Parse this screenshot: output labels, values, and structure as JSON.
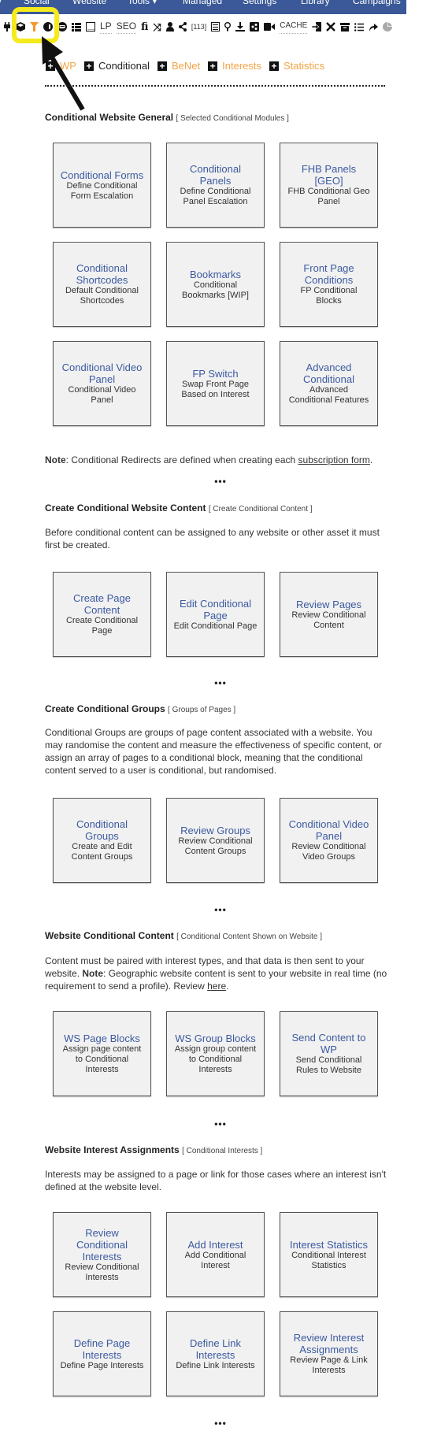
{
  "topnav": {
    "items": [
      "Social",
      "Website",
      "Tools ▾",
      "Managed",
      "Settings",
      "Library",
      "Campaigns"
    ],
    "bg_color": "#3b5998"
  },
  "toolbar": {
    "items": [
      {
        "icon": "plug-icon",
        "glyph": "🔌"
      },
      {
        "icon": "cube-icon",
        "glyph": "⬢"
      },
      {
        "icon": "filter-icon",
        "glyph": "▼",
        "highlighted": true
      },
      {
        "icon": "info-icon",
        "glyph": "❶"
      },
      {
        "icon": "newspaper-icon",
        "glyph": "▣"
      },
      {
        "icon": "list-icon",
        "glyph": "☰"
      },
      {
        "icon": "window-icon",
        "glyph": "☐"
      },
      {
        "text": "LP"
      },
      {
        "text": "SEO"
      },
      {
        "icon": "fi-icon",
        "glyph": "fi"
      },
      {
        "icon": "shuffle-icon",
        "glyph": "⤨"
      },
      {
        "icon": "user-icon",
        "glyph": "●"
      },
      {
        "icon": "share-icon",
        "glyph": "<"
      },
      {
        "text": "[113]"
      },
      {
        "icon": "form-icon",
        "glyph": "▤"
      },
      {
        "icon": "lightbulb-icon",
        "glyph": "♀"
      },
      {
        "icon": "download-icon",
        "glyph": "⤓"
      },
      {
        "icon": "share-square-icon",
        "glyph": "◨"
      },
      {
        "icon": "video-icon",
        "glyph": "■"
      },
      {
        "text": "CACHE"
      },
      {
        "icon": "sign-in-icon",
        "glyph": "⇥"
      },
      {
        "icon": "tools-icon",
        "glyph": "✕"
      },
      {
        "icon": "archive-icon",
        "glyph": "▬"
      },
      {
        "icon": "list-ul-icon",
        "glyph": "≡"
      },
      {
        "icon": "reply-arrow-icon",
        "glyph": "↱"
      },
      {
        "icon": "pie-chart-icon",
        "glyph": "◕"
      }
    ],
    "highlight_color": "#f5ea1b"
  },
  "categories": [
    {
      "label": "WP",
      "active": false
    },
    {
      "label": "Conditional",
      "active": true
    },
    {
      "label": "BeNet",
      "active": false
    },
    {
      "label": "Interests",
      "active": false
    },
    {
      "label": "Statistics",
      "active": false
    }
  ],
  "sections": {
    "general": {
      "title": "Conditional Website General",
      "subtitle": "[ Selected Conditional Modules ]",
      "cards": [
        {
          "title": "Conditional Forms",
          "desc": "Define Conditional Form Escalation"
        },
        {
          "title": "Conditional Panels",
          "desc": "Define Conditional Panel Escalation"
        },
        {
          "title": "FHB Panels [GEO]",
          "desc": "FHB Conditional Geo Panel"
        },
        {
          "title": "Conditional Shortcodes",
          "desc": "Default Conditional Shortcodes"
        },
        {
          "title": "Bookmarks",
          "desc": "Conditional Bookmarks [WIP]"
        },
        {
          "title": "Front Page Conditions",
          "desc": "FP Conditional Blocks"
        },
        {
          "title": "Conditional Video Panel",
          "desc": "Conditional Video Panel"
        },
        {
          "title": "FP Switch",
          "desc": "Swap Front Page Based on Interest"
        },
        {
          "title": "Advanced Conditional",
          "desc": "Advanced Conditional Features"
        }
      ],
      "note_label": "Note",
      "note_text": ": Conditional Redirects are defined when creating each ",
      "note_link": "subscription form",
      "note_end": "."
    },
    "content": {
      "title": "Create Conditional Website Content",
      "subtitle": "[ Create Conditional Content ]",
      "text": "Before conditional content can be assigned to any website or other asset it must first be created.",
      "cards": [
        {
          "title": "Create Page Content",
          "desc": "Create Conditional Page"
        },
        {
          "title": "Edit Conditional Page",
          "desc": "Edit Conditional Page"
        },
        {
          "title": "Review Pages",
          "desc": "Review Conditional Content"
        }
      ]
    },
    "groups": {
      "title": "Create Conditional Groups",
      "subtitle": "[ Groups of Pages ]",
      "text": "Conditional Groups are groups of page content associated with a website. You may randomise the content and measure the effectiveness of specific content, or assign an array of pages to a conditional block, meaning that the conditional content served to a user is conditional, but randomised.",
      "cards": [
        {
          "title": "Conditional Groups",
          "desc": "Create and Edit Content Groups"
        },
        {
          "title": "Review Groups",
          "desc": "Review Conditional Content Groups"
        },
        {
          "title": "Conditional Video Panel",
          "desc": "Review Conditional Video Groups"
        }
      ]
    },
    "website": {
      "title": "Website Conditional Content",
      "subtitle": "[ Conditional Content Shown on Website ]",
      "text_a": "Content must be paired with interest types, and that data is then sent to your website. ",
      "note_label": "Note",
      "text_b": ": Geographic website content is sent to your website in real time (no requirement to send a profile). Review ",
      "link": "here",
      "text_end": ".",
      "cards": [
        {
          "title": "WS Page Blocks",
          "desc": "Assign page content to Conditional Interests"
        },
        {
          "title": "WS Group Blocks",
          "desc": "Assign group content to Conditional Interests"
        },
        {
          "title": "Send Content to WP",
          "desc": "Send Conditional Rules to Website"
        }
      ]
    },
    "interests": {
      "title": "Website Interest Assignments",
      "subtitle": "[ Conditional Interests ]",
      "text": "Interests may be assigned to a page or link for those cases where an interest isn't defined at the website level.",
      "cards": [
        {
          "title": "Review Conditional Interests",
          "desc": "Review Conditional Interests"
        },
        {
          "title": "Add Interest",
          "desc": "Add Conditional Interest"
        },
        {
          "title": "Interest Statistics",
          "desc": "Conditional Interest Statistics"
        },
        {
          "title": "Define Page Interests",
          "desc": "Define Page Interests"
        },
        {
          "title": "Define Link Interests",
          "desc": "Define Link Interests"
        },
        {
          "title": "Review Interest Assignments",
          "desc": "Review Page & Link Interests"
        }
      ]
    }
  },
  "ellipsis": "•••"
}
